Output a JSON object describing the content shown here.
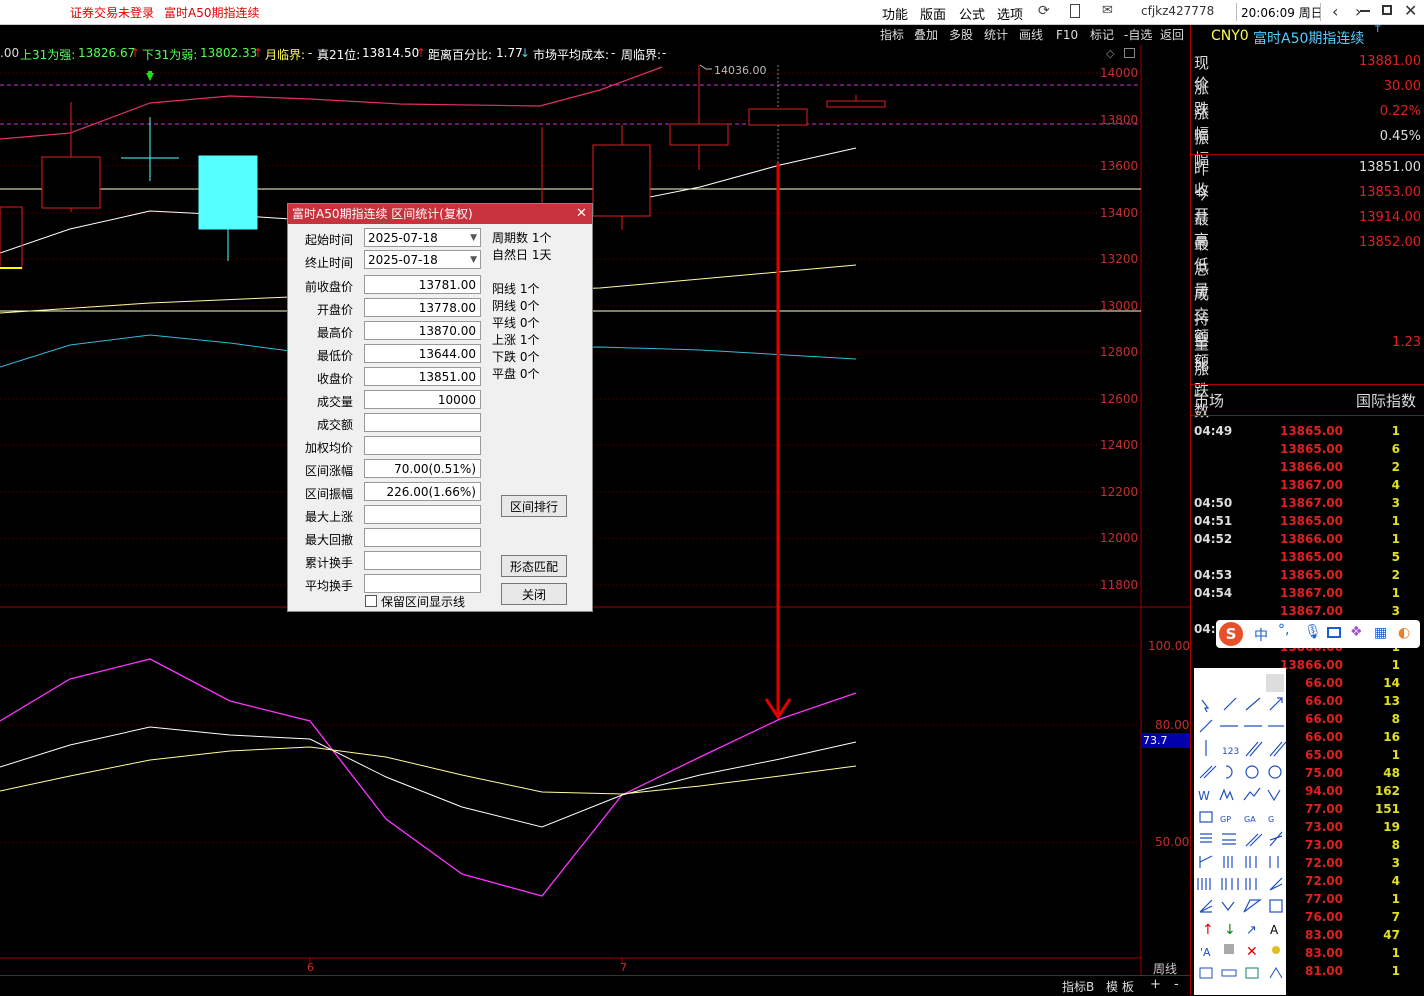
{
  "titlebar": {
    "warning": "证券交易未登录",
    "instrument_title": "富时A50期指连续",
    "menus": [
      "功能",
      "版面",
      "公式",
      "选项"
    ],
    "user": "cfjkz427778",
    "clock": "20:06:09 周日"
  },
  "toolbar": {
    "items": [
      "指标",
      "叠加",
      "多股",
      "统计",
      "画线",
      "F10",
      "标记",
      "-自选",
      "返回"
    ]
  },
  "info_bar": {
    "partial_left": ".00",
    "up31_label": "上31为强:",
    "up31_value": "13826.67",
    "down31_label": "下31为弱:",
    "down31_value": "13802.33",
    "month_label": "月临界:",
    "month_value": "-",
    "true21_label": "真21位:",
    "true21_value": "13814.50",
    "dist_label": "距离百分比:",
    "dist_value": "1.77",
    "avgcost_label": "市场平均成本:",
    "avgcost_value": "-",
    "week_label": "周临界:",
    "week_value": "-"
  },
  "main_chart": {
    "high_annotation": "14036.00",
    "y_labels": [
      "14000",
      "13800",
      "13600",
      "13400",
      "13200",
      "13000",
      "12800",
      "12600",
      "12400",
      "12200",
      "12000",
      "11800"
    ]
  },
  "sub_chart": {
    "y_labels": [
      "100.00",
      "80.00",
      "50.00"
    ],
    "cursor_value": "73.7"
  },
  "x_labels": [
    "6",
    "7"
  ],
  "period_label": "周线",
  "bottom_tabs": [
    "指标B",
    "模 板",
    "+",
    "-"
  ],
  "right_panel": {
    "code": "CNY0",
    "name": "富时A50期指连续",
    "name_sup": "T",
    "quote": [
      {
        "label": "现价",
        "value": "13881.00"
      },
      {
        "label": "涨跌",
        "value": "30.00"
      },
      {
        "label": "涨幅",
        "value": "0.22%"
      },
      {
        "label": "振幅",
        "value": "0.45%"
      }
    ],
    "quote2": [
      {
        "label": "昨收",
        "value": "13851.00"
      },
      {
        "label": "今开",
        "value": "13853.00"
      },
      {
        "label": "最高",
        "value": "13914.00"
      },
      {
        "label": "最低",
        "value": "13852.00"
      },
      {
        "label": "总量",
        "value": ""
      },
      {
        "label": "成交额",
        "value": ""
      },
      {
        "label": "持空额",
        "value": ""
      },
      {
        "label": "量比",
        "value": "1.23"
      },
      {
        "label": "涨跌数",
        "value": ""
      }
    ],
    "market_label": "市场",
    "market_value": "国际指数",
    "ticks": [
      {
        "time": "04:49",
        "price": "13865.00",
        "vol": "1"
      },
      {
        "time": "",
        "price": "13865.00",
        "vol": "6"
      },
      {
        "time": "",
        "price": "13866.00",
        "vol": "2"
      },
      {
        "time": "",
        "price": "13867.00",
        "vol": "4"
      },
      {
        "time": "04:50",
        "price": "13867.00",
        "vol": "3"
      },
      {
        "time": "04:51",
        "price": "13865.00",
        "vol": "1"
      },
      {
        "time": "04:52",
        "price": "13866.00",
        "vol": "1"
      },
      {
        "time": "",
        "price": "13865.00",
        "vol": "5"
      },
      {
        "time": "04:53",
        "price": "13865.00",
        "vol": "2"
      },
      {
        "time": "04:54",
        "price": "13867.00",
        "vol": "1"
      },
      {
        "time": "",
        "price": "13867.00",
        "vol": "3"
      },
      {
        "time": "04:5",
        "price": "",
        "vol": ""
      },
      {
        "time": "",
        "price": "13866.00",
        "vol": "1"
      },
      {
        "time": "",
        "price": "13866.00",
        "vol": "1"
      },
      {
        "time": "",
        "price": "66.00",
        "vol": "14"
      },
      {
        "time": "",
        "price": "66.00",
        "vol": "13"
      },
      {
        "time": "",
        "price": "66.00",
        "vol": "8"
      },
      {
        "time": "",
        "price": "66.00",
        "vol": "16"
      },
      {
        "time": "",
        "price": "65.00",
        "vol": "1"
      },
      {
        "time": "",
        "price": "75.00",
        "vol": "48"
      },
      {
        "time": "",
        "price": "94.00",
        "vol": "162"
      },
      {
        "time": "",
        "price": "77.00",
        "vol": "151"
      },
      {
        "time": "",
        "price": "73.00",
        "vol": "19"
      },
      {
        "time": "",
        "price": "73.00",
        "vol": "8"
      },
      {
        "time": "",
        "price": "72.00",
        "vol": "3"
      },
      {
        "time": "",
        "price": "72.00",
        "vol": "4"
      },
      {
        "time": "",
        "price": "77.00",
        "vol": "1"
      },
      {
        "time": "",
        "price": "76.00",
        "vol": "7"
      },
      {
        "time": "",
        "price": "83.00",
        "vol": "47"
      },
      {
        "time": "",
        "price": "83.00",
        "vol": "1"
      },
      {
        "time": "",
        "price": "81.00",
        "vol": "1"
      }
    ]
  },
  "ime_bar": {
    "logo": "S",
    "mode": "中"
  },
  "dialog": {
    "title": "富时A50期指连续 区间统计(复权)",
    "start_label": "起始时间",
    "start_value": "2025-07-18",
    "end_label": "终止时间",
    "end_value": "2025-07-18",
    "fields": [
      {
        "label": "前收盘价",
        "value": "13781.00"
      },
      {
        "label": "开盘价",
        "value": "13778.00"
      },
      {
        "label": "最高价",
        "value": "13870.00"
      },
      {
        "label": "最低价",
        "value": "13644.00"
      },
      {
        "label": "收盘价",
        "value": "13851.00"
      },
      {
        "label": "成交量",
        "value": "10000"
      },
      {
        "label": "成交额",
        "value": ""
      },
      {
        "label": "加权均价",
        "value": ""
      },
      {
        "label": "区间涨幅",
        "value": "70.00(0.51%)"
      },
      {
        "label": "区间振幅",
        "value": "226.00(1.66%)"
      },
      {
        "label": "最大上涨",
        "value": ""
      },
      {
        "label": "最大回撤",
        "value": ""
      },
      {
        "label": "累计换手",
        "value": ""
      },
      {
        "label": "平均换手",
        "value": ""
      }
    ],
    "period_count": "周期数 1个",
    "natural_days": "自然日 1天",
    "stats": [
      "阳线 1个",
      "阴线 0个",
      "平线 0个",
      "上涨 1个",
      "下跌 0个",
      "平盘 0个"
    ],
    "btn_rank": "区间排行",
    "btn_match": "形态匹配",
    "btn_close": "关闭",
    "checkbox_label": "保留区间显示线"
  },
  "colors": {
    "up": "#e02020",
    "cyan_candle": "#55ffff",
    "magenta": "#ff33ff",
    "white_line": "#ffffff",
    "yellow_line": "#ffff99",
    "arrow_red": "#e00000",
    "grid_red": "#a00000"
  }
}
